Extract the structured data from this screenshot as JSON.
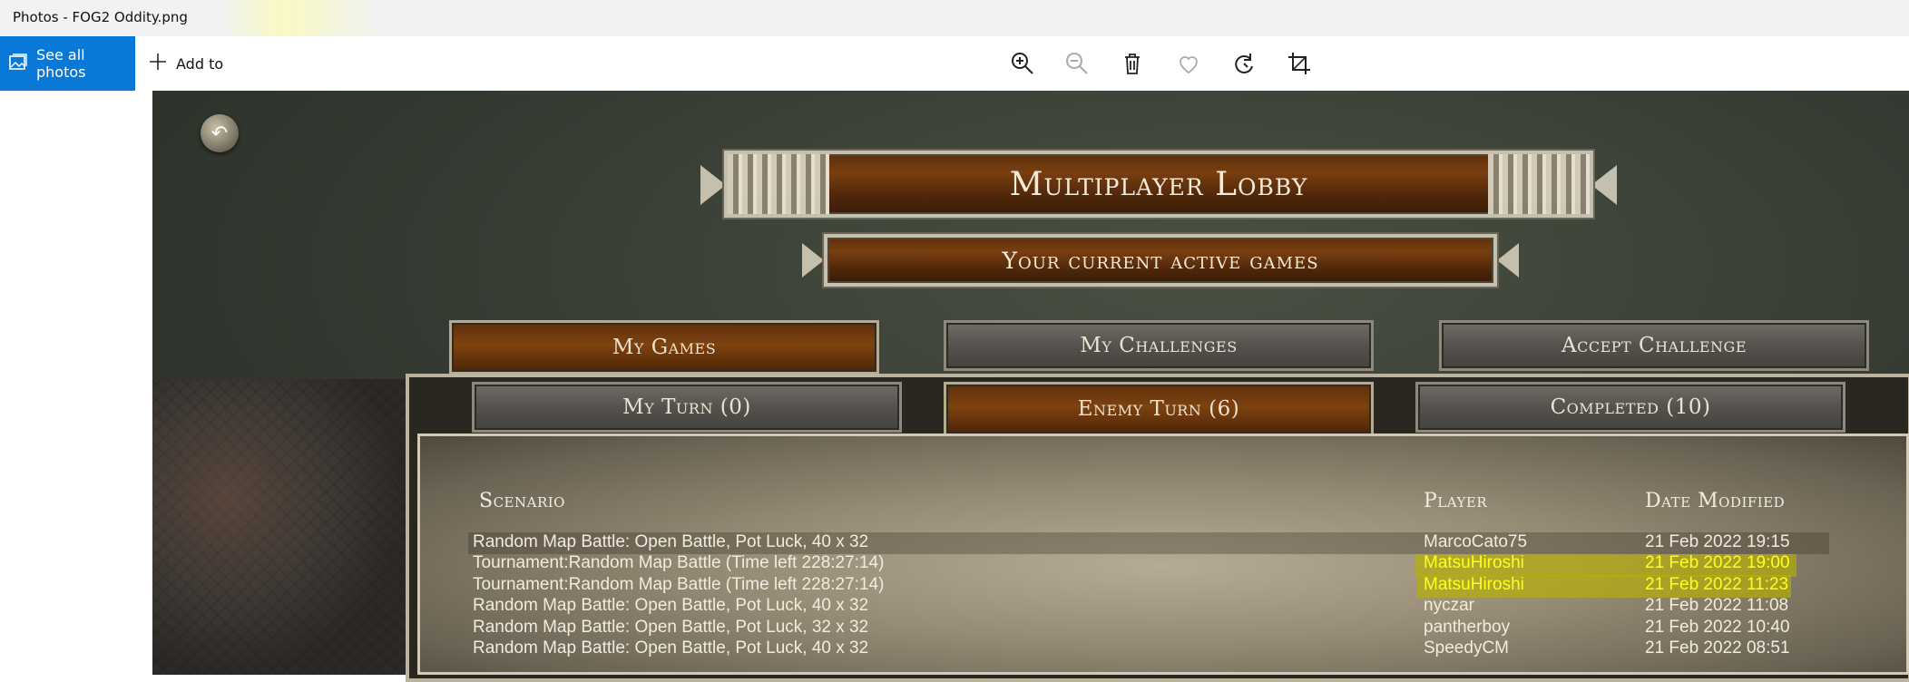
{
  "window": {
    "title": "Photos - FOG2 Oddity.png"
  },
  "toolbar": {
    "see_all_label": "See all photos",
    "add_to_label": "Add to",
    "icons": [
      "zoom-in-icon",
      "zoom-out-icon",
      "trash-icon",
      "heart-icon",
      "rotate-icon",
      "crop-icon"
    ]
  },
  "game": {
    "title": "Multiplayer Lobby",
    "subtitle": "Your current active games",
    "main_tabs": [
      {
        "label": "My Games",
        "active": true
      },
      {
        "label": "My Challenges",
        "active": false
      },
      {
        "label": "Accept Challenge",
        "active": false
      }
    ],
    "sub_tabs": [
      {
        "label": "My Turn (0)",
        "active": false
      },
      {
        "label": "Enemy Turn (6)",
        "active": true
      },
      {
        "label": "Completed (10)",
        "active": false
      }
    ],
    "columns": {
      "scenario": "Scenario",
      "player": "Player",
      "date": "Date Modified"
    },
    "rows": [
      {
        "scenario": "Random Map Battle: Open Battle, Pot Luck, 40 x 32",
        "player": "MarcoCato75",
        "date": "21 Feb 2022 19:15",
        "highlighted": false
      },
      {
        "scenario": "Tournament:Random Map Battle (Time left 228:27:14)",
        "player": "MatsuHiroshi",
        "date": "21 Feb 2022 19:00",
        "highlighted": true
      },
      {
        "scenario": "Tournament:Random Map Battle (Time left 228:27:14)",
        "player": "MatsuHiroshi",
        "date": "21 Feb 2022 11:23",
        "highlighted": true
      },
      {
        "scenario": "Random Map Battle: Open Battle, Pot Luck, 40 x 32",
        "player": "nyczar",
        "date": "21 Feb 2022 11:08",
        "highlighted": false
      },
      {
        "scenario": "Random Map Battle: Open Battle, Pot Luck, 32 x 32",
        "player": "pantherboy",
        "date": "21 Feb 2022 10:40",
        "highlighted": false
      },
      {
        "scenario": "Random Map Battle: Open Battle, Pot Luck, 40 x 32",
        "player": "SpeedyCM",
        "date": "21 Feb 2022 08:51",
        "highlighted": false
      }
    ]
  },
  "colors": {
    "accent": "#0a78d7",
    "highlight_text": "#ffff1a",
    "highlight_marker": "#b8b000"
  }
}
